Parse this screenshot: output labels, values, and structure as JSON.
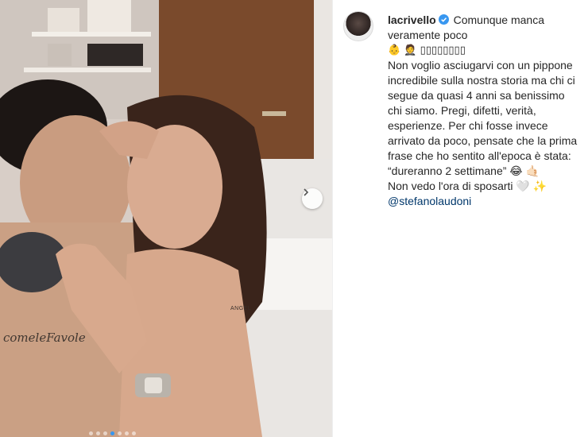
{
  "post": {
    "username": "lacrivello",
    "verified_icon": "verified-badge-icon",
    "caption_lines": [
      "Comunque manca",
      "veramente poco",
      "👶 🤵 ▯▯▯▯▯▯▯▯",
      "Non voglio asciugarvi con un pippone",
      "incredibile sulla nostra storia ma chi ci",
      "segue da quasi 4 anni sa benissimo",
      "chi siamo. Pregi, difetti, verità,",
      "esperienze. Per chi fosse invece",
      "arrivato da poco, pensate che la prima",
      "frase che ho sentito all'epoca è stata:",
      "“dureranno 2 settimane” 😂 🤙🏻",
      "Non vedo l'ora di sposarti 🤍 ✨"
    ],
    "mention": "@stefanolaudoni"
  },
  "carousel": {
    "dot_count": 7,
    "active_index": 3,
    "accent": "#3897f0"
  },
  "photo_text": {
    "tattoo_chest": "comeleFavole",
    "tattoo_arm": "ANGEL"
  }
}
